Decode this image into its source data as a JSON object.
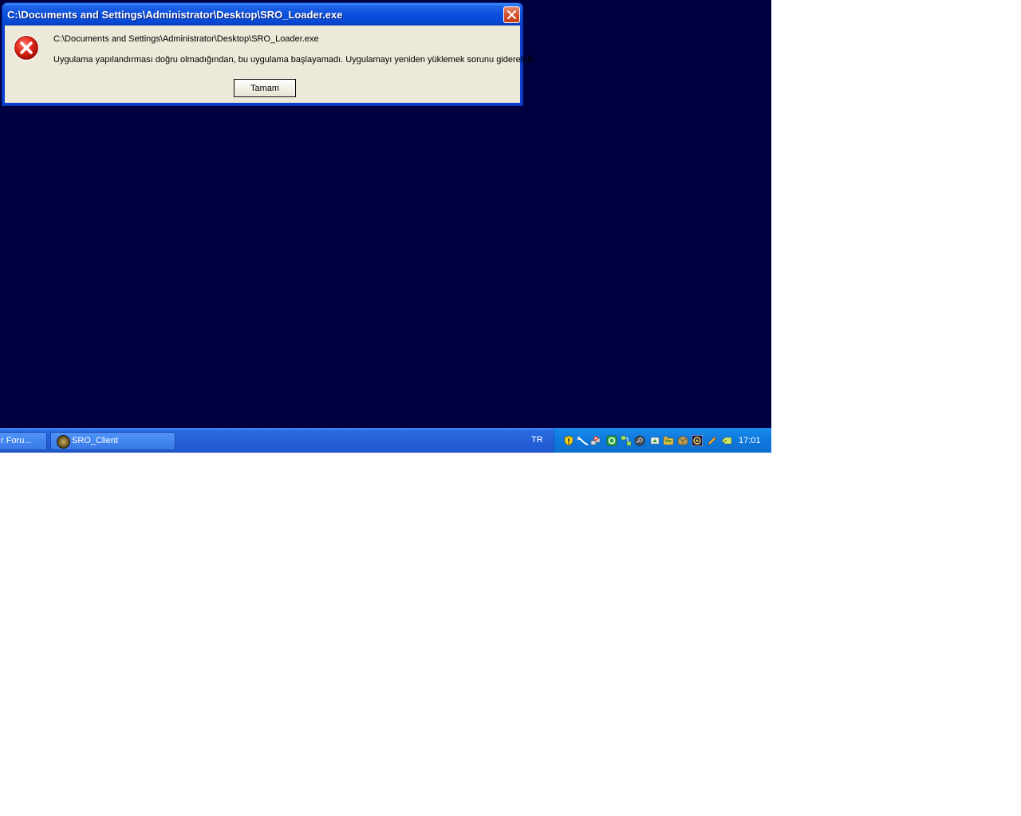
{
  "dialog": {
    "title": "C:\\Documents and Settings\\Administrator\\Desktop\\SRO_Loader.exe",
    "path_text": "C:\\Documents and Settings\\Administrator\\Desktop\\SRO_Loader.exe",
    "message": "Uygulama yapılandırması doğru olmadığından, bu uygulama başlayamadı. Uygulamayı yeniden yüklemek sorunu giderebilir.",
    "ok_label": "Tamam",
    "icon": "error-icon"
  },
  "taskbar": {
    "tasks": [
      {
        "label": "r Foru..."
      },
      {
        "label": "SRO_Client"
      }
    ],
    "language": "TR",
    "clock": "17:01",
    "tray_icons": [
      "shield-warning-icon",
      "network-cable-icon",
      "network-disconnected-icon",
      "green-app-icon",
      "network-icon",
      "steam-icon",
      "update-icon",
      "folder-icon",
      "package-icon",
      "media-icon",
      "wifi-icon",
      "pencil-icon",
      "tag-icon"
    ]
  },
  "colors": {
    "desktop": "#000040",
    "taskbar": "#245edb",
    "tray": "#0f7ddb",
    "dialog_body": "#ece9d8"
  }
}
